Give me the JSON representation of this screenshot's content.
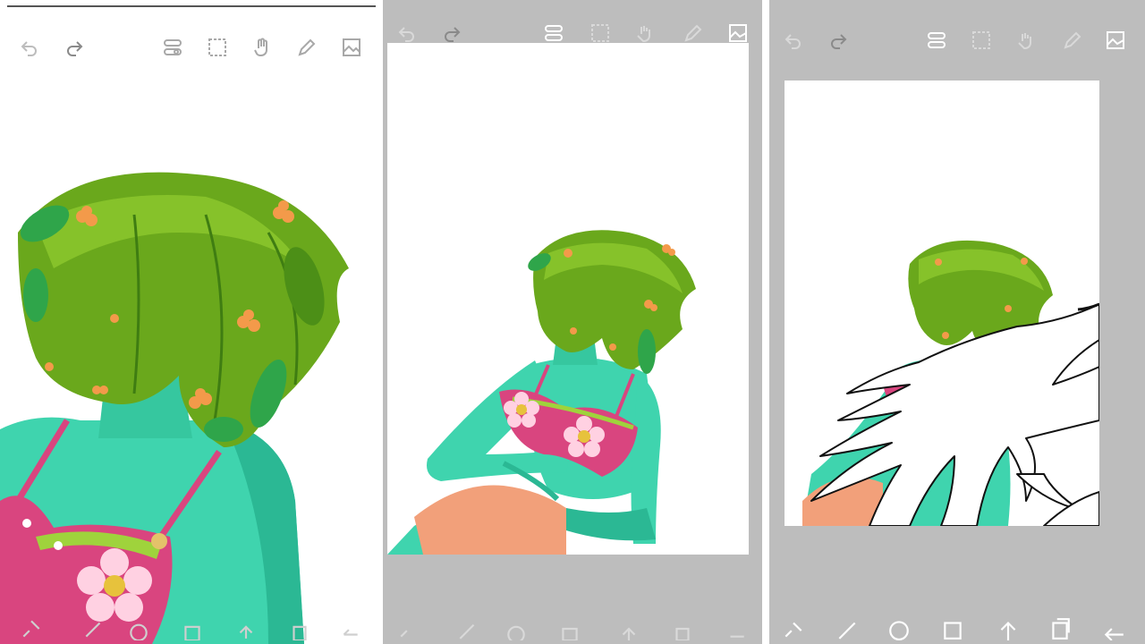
{
  "colors": {
    "skin": "#3fd4ae",
    "skin_shadow": "#2bb894",
    "hair": "#6aa81c",
    "hair_dark": "#3f7d12",
    "leaf": "#2fa54a",
    "berry": "#f39a4a",
    "bra": "#d9457f",
    "bra_dark": "#b8305f",
    "flower": "#ffd1e2",
    "shorts": "#f2a07a",
    "lineart": "#111111",
    "panel_bg": "#bdbdbd",
    "toolbar_icon": "#9e9e9e"
  },
  "toolbar_icons": [
    "undo-icon",
    "redo-icon",
    "layers-toggle-icon",
    "selection-icon",
    "transform-hand-icon",
    "pencil-icon",
    "image-icon"
  ],
  "bottombar_icons": [
    "lasso-icon",
    "brush-icon",
    "ellipse-icon",
    "rectangle-icon",
    "arrow-up-icon",
    "copy-icon",
    "back-arrow-icon"
  ],
  "panels": [
    {
      "id": "panel-zoomed",
      "view": "zoomed-in"
    },
    {
      "id": "panel-full",
      "view": "full-figure"
    },
    {
      "id": "panel-lineart",
      "view": "with-lineart"
    }
  ]
}
